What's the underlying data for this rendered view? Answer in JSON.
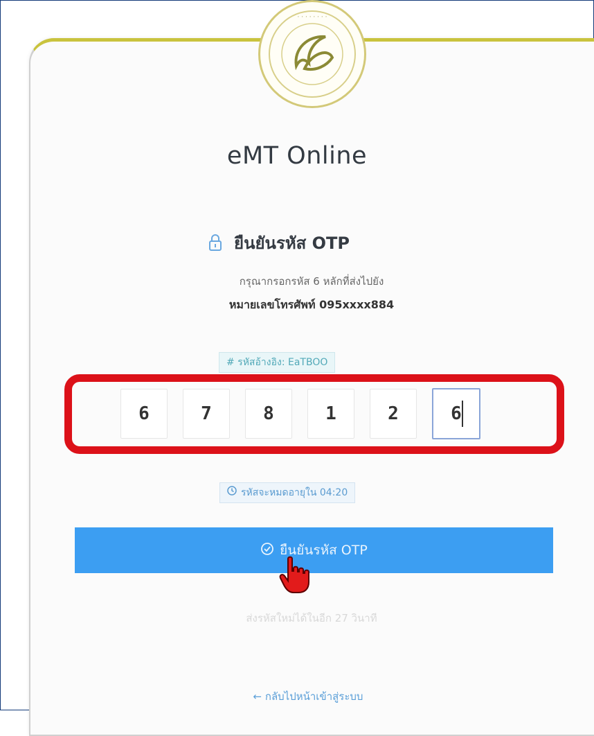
{
  "app": {
    "title": "eMT Online"
  },
  "otp_section": {
    "heading": "ยืนยันรหัส OTP",
    "instruction_line1": "กรุณากรอกรหัส 6 หลักที่ส่งไปยัง",
    "instruction_line2": "หมายเลขโทรศัพท์ 095xxxx884",
    "reference_label": "# รหัสอ้างอิง: EaTBOO",
    "otp_digits": [
      "6",
      "7",
      "8",
      "1",
      "2",
      "6"
    ],
    "timer_label": "รหัสจะหมดอายุใน 04:20",
    "confirm_button_label": "ยืนยันรหัส OTP",
    "resend_label": "ส่งรหัสใหม่ได้ในอีก 27 วินาที",
    "back_link_label": "← กลับไปหน้าเข้าสู่ระบบ"
  },
  "icons": {
    "heading_icon": "lock-icon",
    "timer_icon": "clock-icon",
    "button_icon": "check-circle-icon",
    "cursor": "hand-pointer-icon"
  },
  "colors": {
    "highlight": "#dc1119",
    "button": "#3c9ef2",
    "card_accent": "#c9c33d"
  }
}
